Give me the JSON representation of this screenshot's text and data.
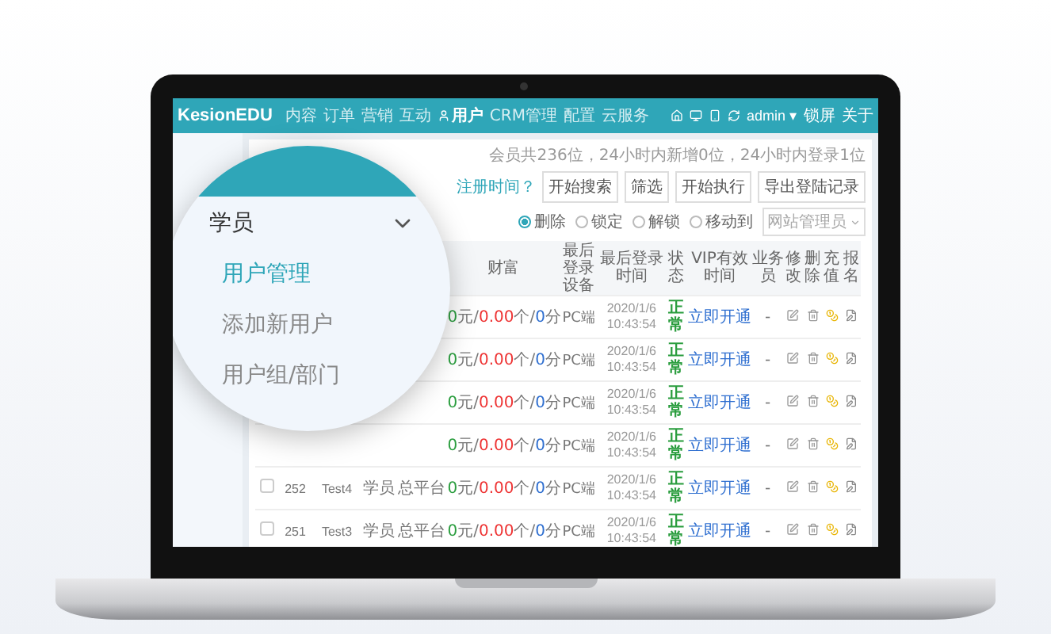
{
  "screen": {
    "logo": "KesionEDU",
    "nav": [
      {
        "label": "内容",
        "selected": false
      },
      {
        "label": "订单",
        "selected": false
      },
      {
        "label": "营销",
        "selected": false
      },
      {
        "label": "互动",
        "selected": false
      },
      {
        "label": "用户",
        "selected": true
      },
      {
        "label": "CRM管理",
        "selected": false
      },
      {
        "label": "配置",
        "selected": false
      },
      {
        "label": "云服务",
        "selected": false
      }
    ],
    "user_menu": {
      "user": "admin ▾",
      "links": [
        "锁屏",
        "关于"
      ]
    },
    "stats": "会员共236位，24小时内新增0位，24小时内登录1位",
    "toolbar": {
      "filter_link": "注册时间？",
      "buttons": [
        "开始搜索",
        "筛选",
        "开始执行",
        "导出登陆记录"
      ]
    },
    "actions": [
      {
        "label": "删除",
        "selected": true
      },
      {
        "label": "锁定",
        "selected": false
      },
      {
        "label": "解锁",
        "selected": false
      },
      {
        "label": "移动到",
        "selected": false
      }
    ],
    "target_select": "网站管理员",
    "table": {
      "columns": [
        "财富",
        "最后登录设备",
        "最后登录时间",
        "状态",
        "VIP有效时间",
        "业务员",
        "修改",
        "删除",
        "充值",
        "报名"
      ],
      "rows": [
        {
          "wealth": [
            "0",
            "元/",
            "0.00",
            "个/",
            "0",
            "分"
          ],
          "device": "PC端",
          "time": "2020/1/6 10:43:54",
          "status": "正常",
          "vip": "立即开通",
          "sales": "-"
        },
        {
          "wealth": [
            "0",
            "元/",
            "0.00",
            "个/",
            "0",
            "分"
          ],
          "device": "PC端",
          "time": "2020/1/6 10:43:54",
          "status": "正常",
          "vip": "立即开通",
          "sales": "-"
        },
        {
          "wealth": [
            "0",
            "元/",
            "0.00",
            "个/",
            "0",
            "分"
          ],
          "device": "PC端",
          "time": "2020/1/6 10:43:54",
          "status": "正常",
          "vip": "立即开通",
          "sales": "-"
        },
        {
          "wealth": [
            "0",
            "元/",
            "0.00",
            "个/",
            "0",
            "分"
          ],
          "device": "PC端",
          "time": "2020/1/6 10:43:54",
          "status": "正常",
          "vip": "立即开通",
          "sales": "-"
        },
        {
          "checked": false,
          "id": "252",
          "name": "Test4",
          "role": "学员",
          "platform": "总平台",
          "wealth": [
            "0",
            "元/",
            "0.00",
            "个/",
            "0",
            "分"
          ],
          "device": "PC端",
          "time": "2020/1/6 10:43:54",
          "status": "正常",
          "vip": "立即开通",
          "sales": "-"
        },
        {
          "checked": false,
          "id": "251",
          "name": "Test3",
          "role": "学员",
          "platform": "总平台",
          "wealth": [
            "0",
            "元/",
            "0.00",
            "个/",
            "0",
            "分"
          ],
          "device": "PC端",
          "time": "2020/1/6 10:43:54",
          "status": "正常",
          "vip": "立即开通",
          "sales": "-"
        }
      ]
    }
  },
  "magnifier": {
    "group": "学员",
    "expanded": true,
    "items": [
      {
        "label": "用户管理",
        "selected": true
      },
      {
        "label": "添加新用户",
        "selected": false
      },
      {
        "label": "用户组/部门",
        "selected": false
      }
    ]
  }
}
